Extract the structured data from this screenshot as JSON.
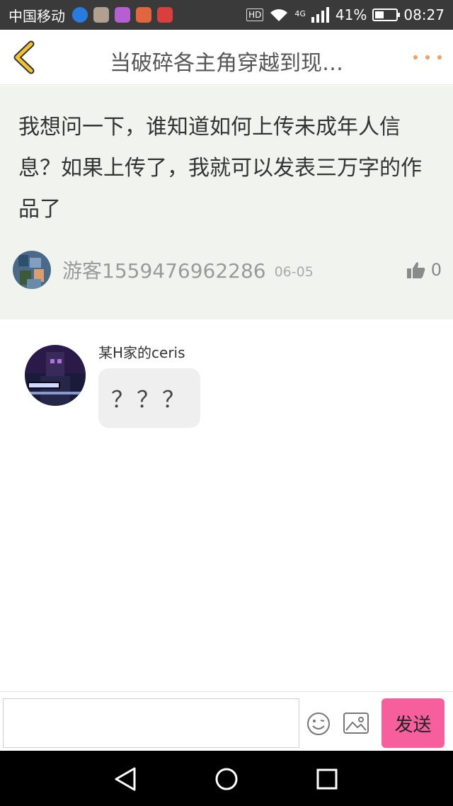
{
  "status_bar": {
    "carrier": "中国移动",
    "hd": "HD",
    "network": "4G",
    "battery": "41%",
    "battery_level": 0.41,
    "time": "08:27"
  },
  "header": {
    "title": "当破碎各主角穿越到现…"
  },
  "post": {
    "text": "我想问一下，谁知道如何上传未成年人信息？如果上传了，我就可以发表三万字的作品了",
    "author": "游客1559476962286",
    "date": "06-05",
    "likes": "0"
  },
  "comments": [
    {
      "author": "某H家的ceris",
      "text": "？？？"
    }
  ],
  "input_bar": {
    "placeholder": "",
    "send_label": "发送"
  },
  "colors": {
    "accent": "#f65f9c",
    "back_icon": "#f2c230",
    "more_icon": "#f0a060",
    "post_bg": "#f1f3ef"
  }
}
